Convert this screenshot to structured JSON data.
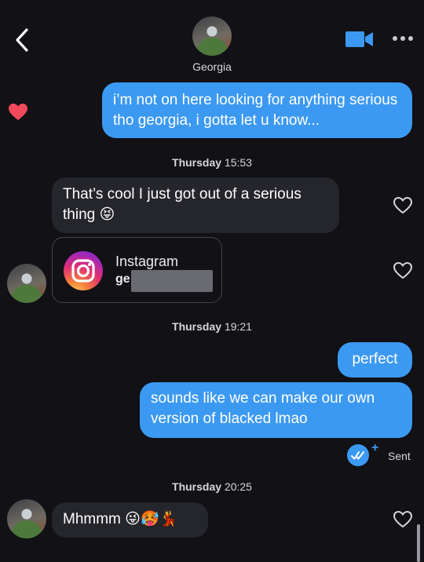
{
  "header": {
    "contact_name": "Georgia",
    "back_icon": "chevron-left-icon",
    "video_icon": "video-camera-icon",
    "more_icon": "ellipsis-icon",
    "accent_color": "#3c99f2"
  },
  "messages": {
    "m1": {
      "direction": "out",
      "text": "i’m not on here looking for anything serious tho georgia, i gotta let u know...",
      "liked": true
    },
    "ts1": {
      "day": "Thursday",
      "time": "15:53"
    },
    "m2": {
      "direction": "in",
      "text": "That’s cool I just got out of a serious thing 😝"
    },
    "m3": {
      "direction": "in",
      "type": "instagram-card",
      "title": "Instagram",
      "username_visible": "ge"
    },
    "ts2": {
      "day": "Thursday",
      "time": "19:21"
    },
    "m4": {
      "direction": "out",
      "text": "perfect"
    },
    "m5": {
      "direction": "out",
      "text": "sounds like we can make our own version of blacked lmao"
    },
    "status": {
      "label": "Sent"
    },
    "ts3": {
      "day": "Thursday",
      "time": "20:25"
    },
    "m6": {
      "direction": "in",
      "text": "Mhmmm 😜🥵💃"
    }
  }
}
